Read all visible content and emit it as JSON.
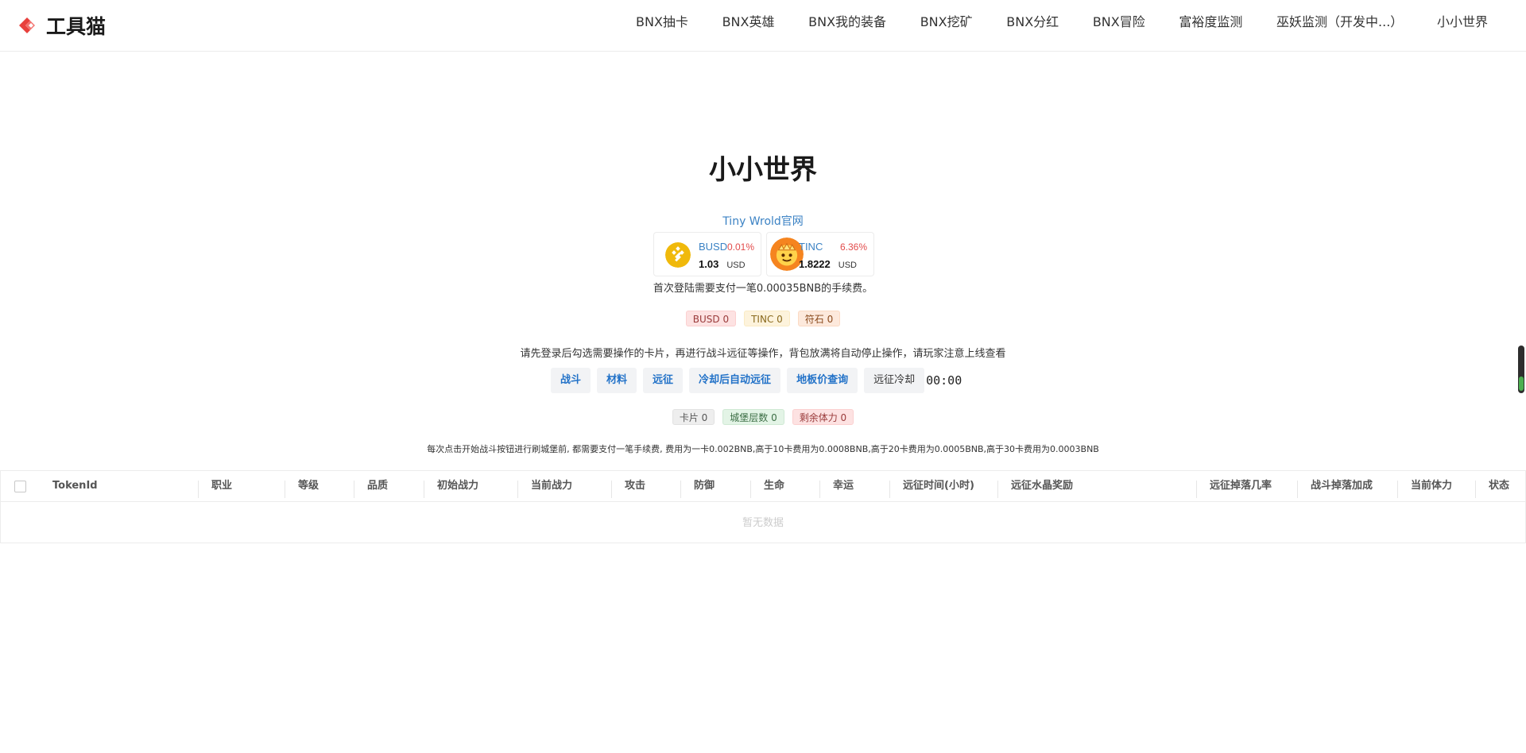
{
  "header": {
    "logo_text": "工具猫",
    "nav": [
      "BNX抽卡",
      "BNX英雄",
      "BNX我的装备",
      "BNX挖矿",
      "BNX分红",
      "BNX冒险",
      "富裕度监测",
      "巫妖监测（开发中...）",
      "小小世界"
    ]
  },
  "page": {
    "title": "小小世界",
    "official_link": "Tiny Wrold官网",
    "fee_note": "首次登陆需要支付一笔0.00035BNB的手续费。",
    "instruction": "请先登录后勾选需要操作的卡片，再进行战斗远征等操作，背包放满将自动停止操作，请玩家注意上线查看",
    "fee_rules": "每次点击开始战斗按钮进行刷城堡前, 都需要支付一笔手续费, 费用为一卡0.002BNB,高于10卡费用为0.0008BNB,高于20卡费用为0.0005BNB,高于30卡费用为0.0003BNB"
  },
  "tokens": [
    {
      "name": "BUSD",
      "change": "0.01%",
      "price": "1.03",
      "unit": "USD",
      "logo_color": "#f0b90b"
    },
    {
      "name": "TINC",
      "change": "6.36%",
      "price": "1.8222",
      "unit": "USD",
      "logo_color": "#f5841f"
    }
  ],
  "balances": {
    "busd": "BUSD 0",
    "tinc": "TINC 0",
    "rune": "符石 0"
  },
  "actions": {
    "battle": "战斗",
    "material": "材料",
    "expedition": "远征",
    "auto_expedition": "冷却后自动远征",
    "floor_price": "地板价查询",
    "cooldown_label": "远征冷却",
    "cooldown_time": "00:00"
  },
  "counts": {
    "cards": "卡片 0",
    "castle_floors": "城堡层数 0",
    "stamina": "剩余体力 0"
  },
  "table": {
    "columns": [
      "TokenId",
      "职业",
      "等级",
      "品质",
      "初始战力",
      "当前战力",
      "攻击",
      "防御",
      "生命",
      "幸运",
      "远征时间(小时)",
      "远征水晶奖励",
      "远征掉落几率",
      "战斗掉落加成",
      "当前体力",
      "状态"
    ],
    "empty_text": "暂无数据"
  },
  "colors": {
    "link": "#3b82c4",
    "action": "#2272c8",
    "negative_change": "#e24b4b"
  }
}
